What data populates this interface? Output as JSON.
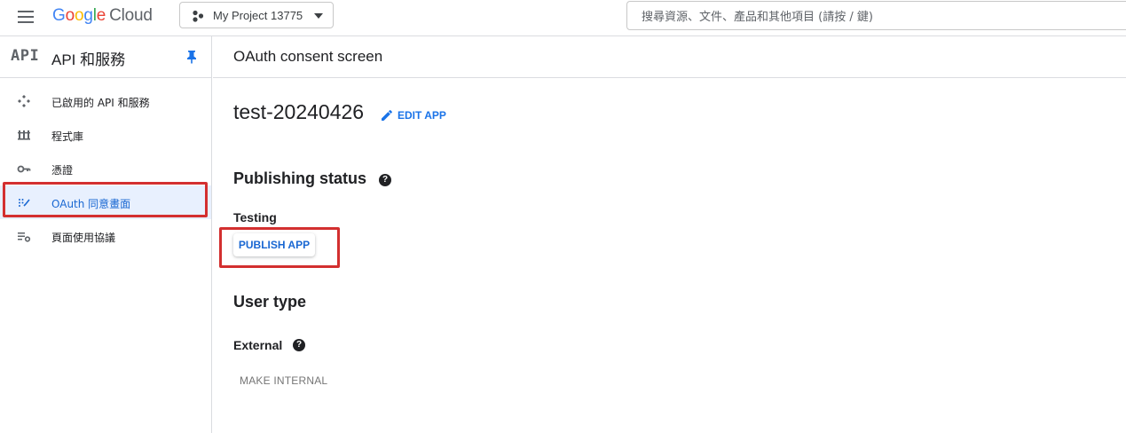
{
  "header": {
    "logo_google": [
      "G",
      "o",
      "o",
      "g",
      "l",
      "e"
    ],
    "logo_cloud": "Cloud",
    "project_name": "My Project 13775",
    "search_placeholder": "搜尋資源、文件、產品和其他項目 (請按 / 鍵)"
  },
  "sidebar": {
    "badge": "API",
    "title": "API 和服務",
    "items": [
      {
        "label": "已啟用的 API 和服務",
        "icon": "api-diamond-icon"
      },
      {
        "label": "程式庫",
        "icon": "library-icon"
      },
      {
        "label": "憑證",
        "icon": "key-icon"
      },
      {
        "label": "OAuth 同意畫面",
        "icon": "oauth-consent-icon",
        "active": true
      },
      {
        "label": "頁面使用協議",
        "icon": "page-usage-settings-icon"
      }
    ]
  },
  "main": {
    "page_title": "OAuth consent screen",
    "app_name": "test-20240426",
    "edit_app_label": "EDIT APP",
    "publishing_status_title": "Publishing status",
    "publishing_status_value": "Testing",
    "publish_button_label": "PUBLISH APP",
    "user_type_title": "User type",
    "user_type_value": "External",
    "make_internal_label": "MAKE INTERNAL"
  },
  "colors": {
    "accent": "#1a73e8",
    "active_bg": "#e8f0fe",
    "highlight_red": "#d32f2f",
    "divider": "#dadce0"
  }
}
